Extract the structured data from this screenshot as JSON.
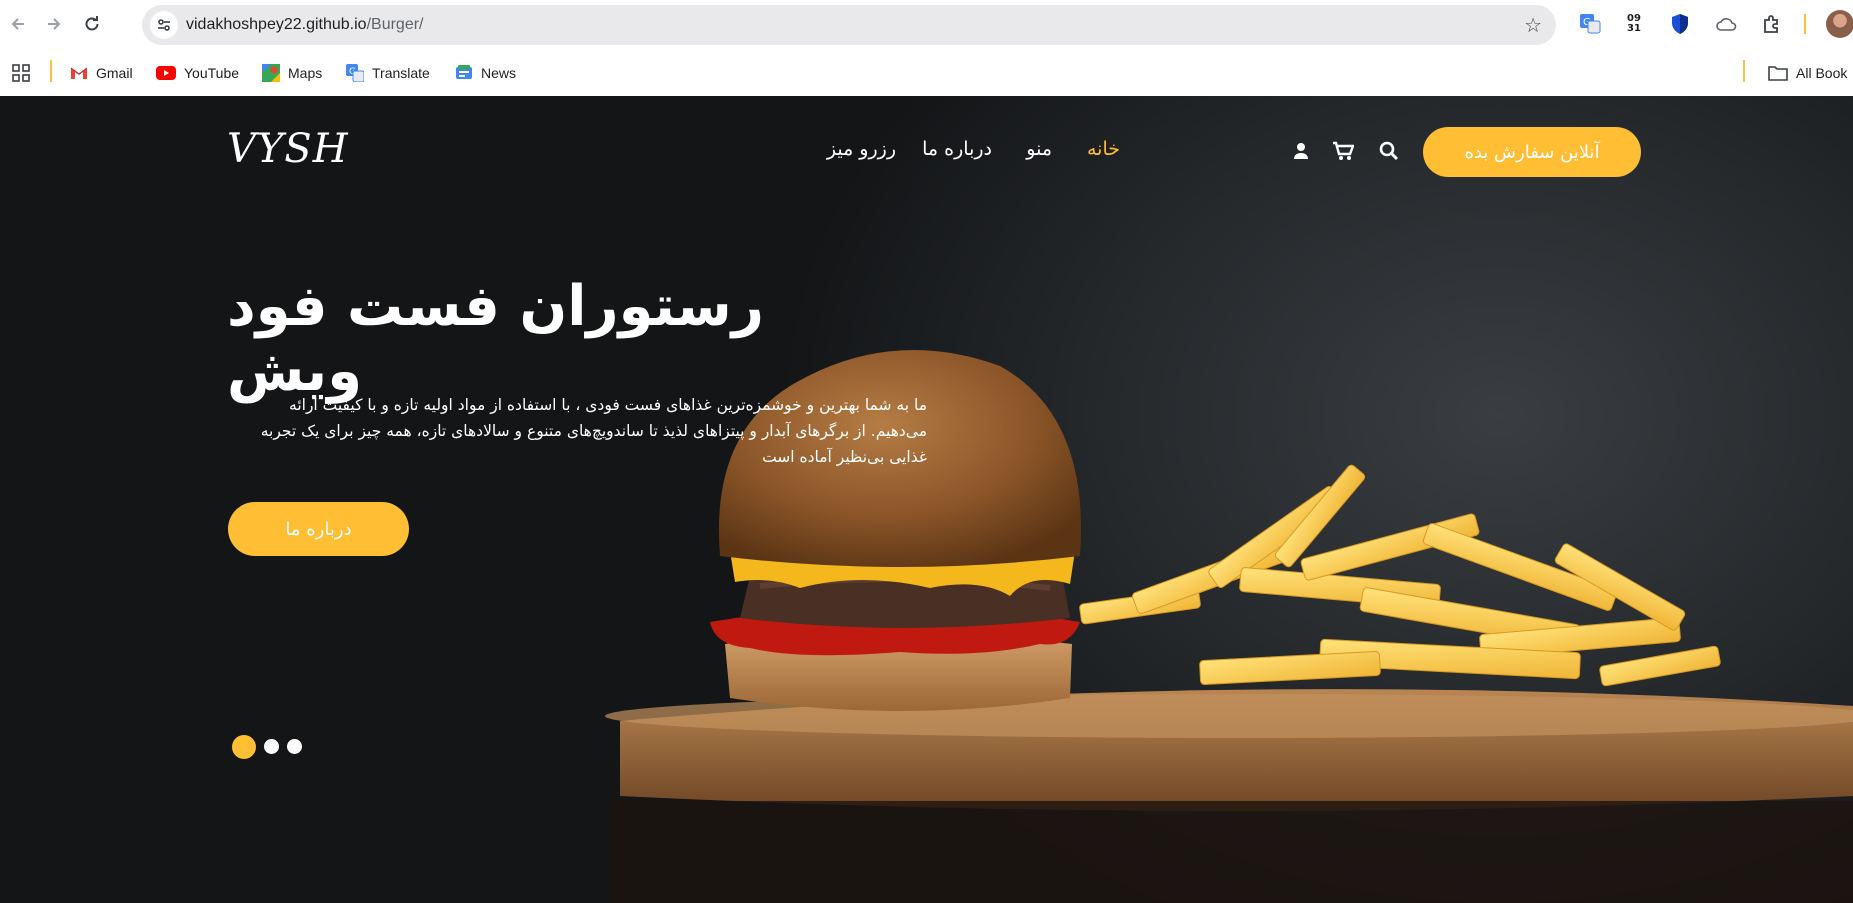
{
  "browser": {
    "url_host": "vidakhoshpey22.github.io",
    "url_path": "/Burger/",
    "clock_ext": "09\n31",
    "bookmarks": [
      {
        "label": "Gmail",
        "icon": "gmail-icon"
      },
      {
        "label": "YouTube",
        "icon": "youtube-icon"
      },
      {
        "label": "Maps",
        "icon": "maps-icon"
      },
      {
        "label": "Translate",
        "icon": "translate-icon"
      },
      {
        "label": "News",
        "icon": "news-icon"
      }
    ],
    "all_bookmarks": "All Book"
  },
  "site": {
    "logo": "VYSH",
    "menu": [
      {
        "label": "خانه",
        "active": true
      },
      {
        "label": "منو",
        "active": false
      },
      {
        "label": "درباره ما",
        "active": false
      },
      {
        "label": "رزرو میز",
        "active": false
      }
    ],
    "order_button": "آنلاین سفارش بده",
    "hero_title": "رستوران فست فود ویش",
    "hero_text": "ما به شما بهترین و خوشمزه‌ترین غذاهای فست فودی ، با استفاده از مواد اولیه تازه و با کیفیت ارائه می‌دهیم. از برگرهای آبدار و پیتزاهای لذیذ تا ساندویچ‌های متنوع و سالادهای تازه، همه چیز برای یک تجربه غذایی بی‌نظیر آماده است",
    "about_button": "درباره ما",
    "carousel_active_index": 0,
    "carousel_count": 3
  },
  "colors": {
    "accent": "#ffbe33",
    "dark_bg": "#131517"
  }
}
